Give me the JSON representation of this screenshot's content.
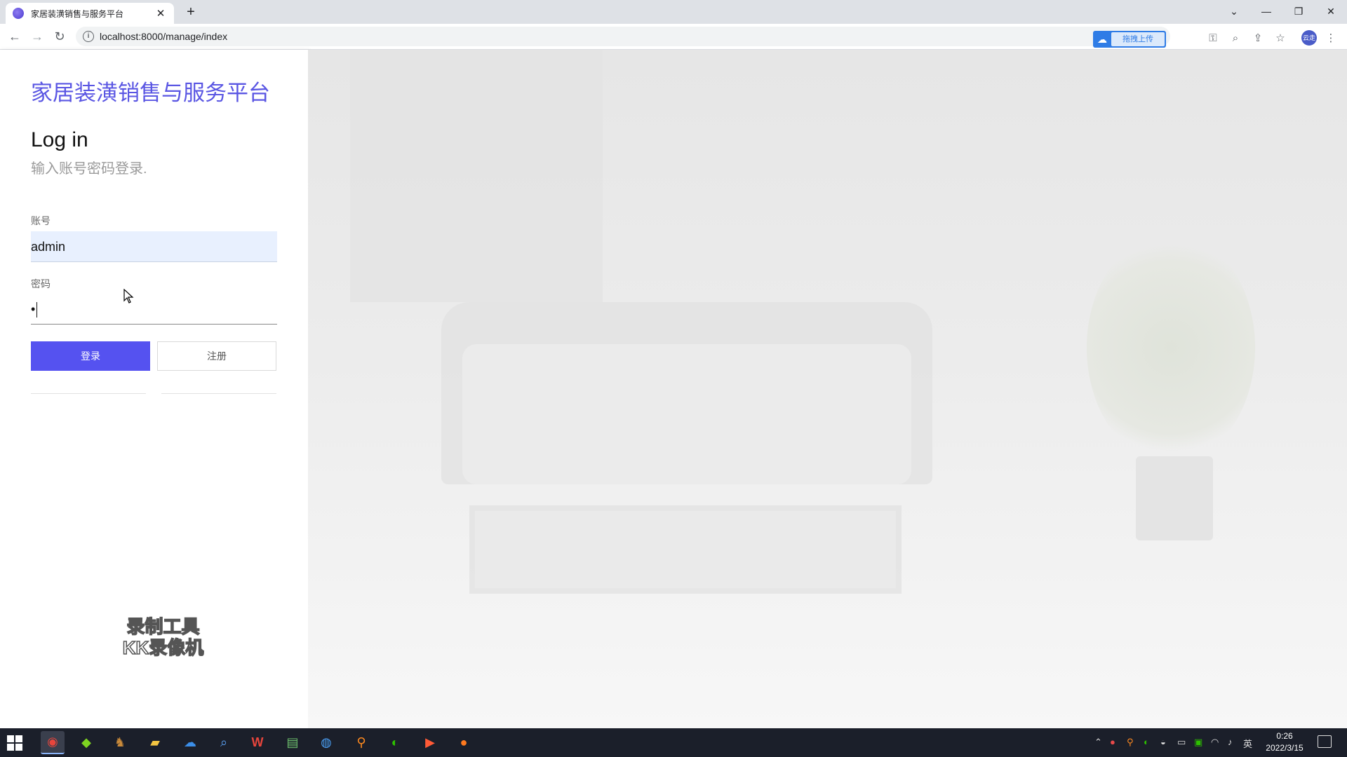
{
  "browser": {
    "tab_title": "家居装潢销售与服务平台",
    "new_tab": "+",
    "tab_close": "✕",
    "url": "localhost:8000/manage/index",
    "extension_label": "拖拽上传",
    "avatar_text": "云走"
  },
  "page": {
    "site_title": "家居装潢销售与服务平台",
    "login_heading": "Log in",
    "login_subtitle": "输入账号密码登录.",
    "account_label": "账号",
    "account_value": "admin",
    "password_label": "密码",
    "password_value": "•",
    "login_button": "登录",
    "register_button": "注册"
  },
  "watermark": {
    "line1": "录制工具",
    "line2": "KK录像机"
  },
  "taskbar": {
    "time": "0:26",
    "date": "2022/3/15",
    "ime": "英"
  },
  "colors": {
    "accent": "#5552f0",
    "title": "#5a56e3",
    "input_fill": "#e8f0fe"
  }
}
